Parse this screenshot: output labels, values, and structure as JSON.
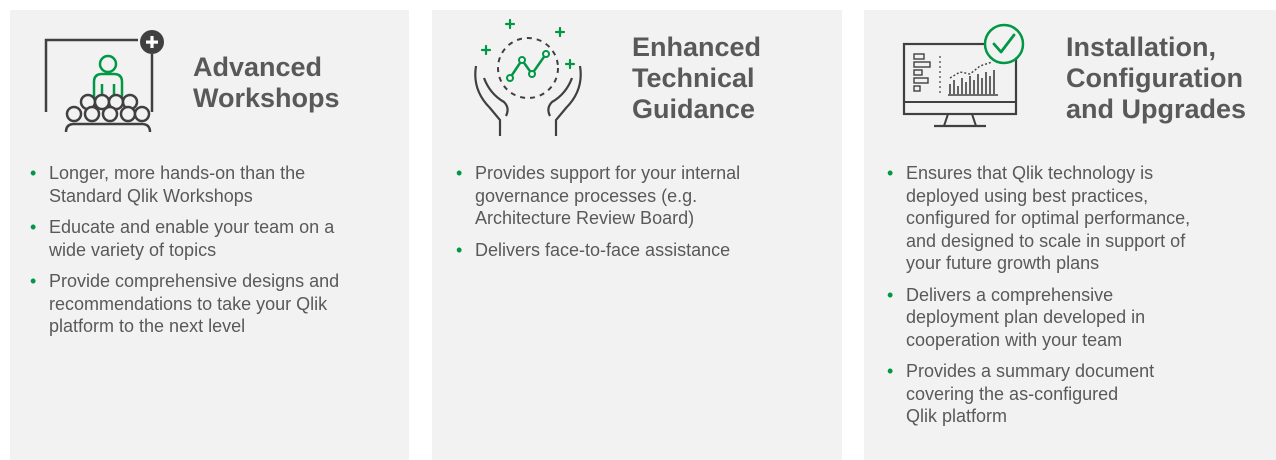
{
  "colors": {
    "accent": "#009845",
    "text": "#595959",
    "card": "#f2f2f2",
    "icon_stroke": "#404040"
  },
  "cards": [
    {
      "icon": "workshop-presentation-icon",
      "title_lines": [
        "Advanced",
        "Workshops"
      ],
      "bullets": [
        [
          "Longer, more hands-on than the",
          "Standard Qlik Workshops"
        ],
        [
          "Educate and enable your team on a",
          "wide variety of topics"
        ],
        [
          "Provide comprehensive designs and",
          "recommendations to take your Qlik",
          "platform to the next level"
        ]
      ]
    },
    {
      "icon": "hands-chart-guidance-icon",
      "title_lines": [
        "Enhanced",
        "Technical",
        "Guidance"
      ],
      "bullets": [
        [
          "Provides support for your internal",
          "governance processes (e.g.",
          "Architecture Review Board)"
        ],
        [
          "Delivers face-to-face assistance"
        ]
      ]
    },
    {
      "icon": "monitor-checkmark-icon",
      "title_lines": [
        "Installation,",
        "Configuration",
        "and Upgrades"
      ],
      "bullets": [
        [
          "Ensures that Qlik technology is",
          "deployed using best practices,",
          "configured for optimal performance,",
          "and designed to scale in support of",
          "your future growth plans"
        ],
        [
          "Delivers a comprehensive",
          "deployment plan developed in",
          "cooperation with your team"
        ],
        [
          "Provides a summary document",
          "covering the as-configured",
          "Qlik platform"
        ]
      ]
    }
  ]
}
